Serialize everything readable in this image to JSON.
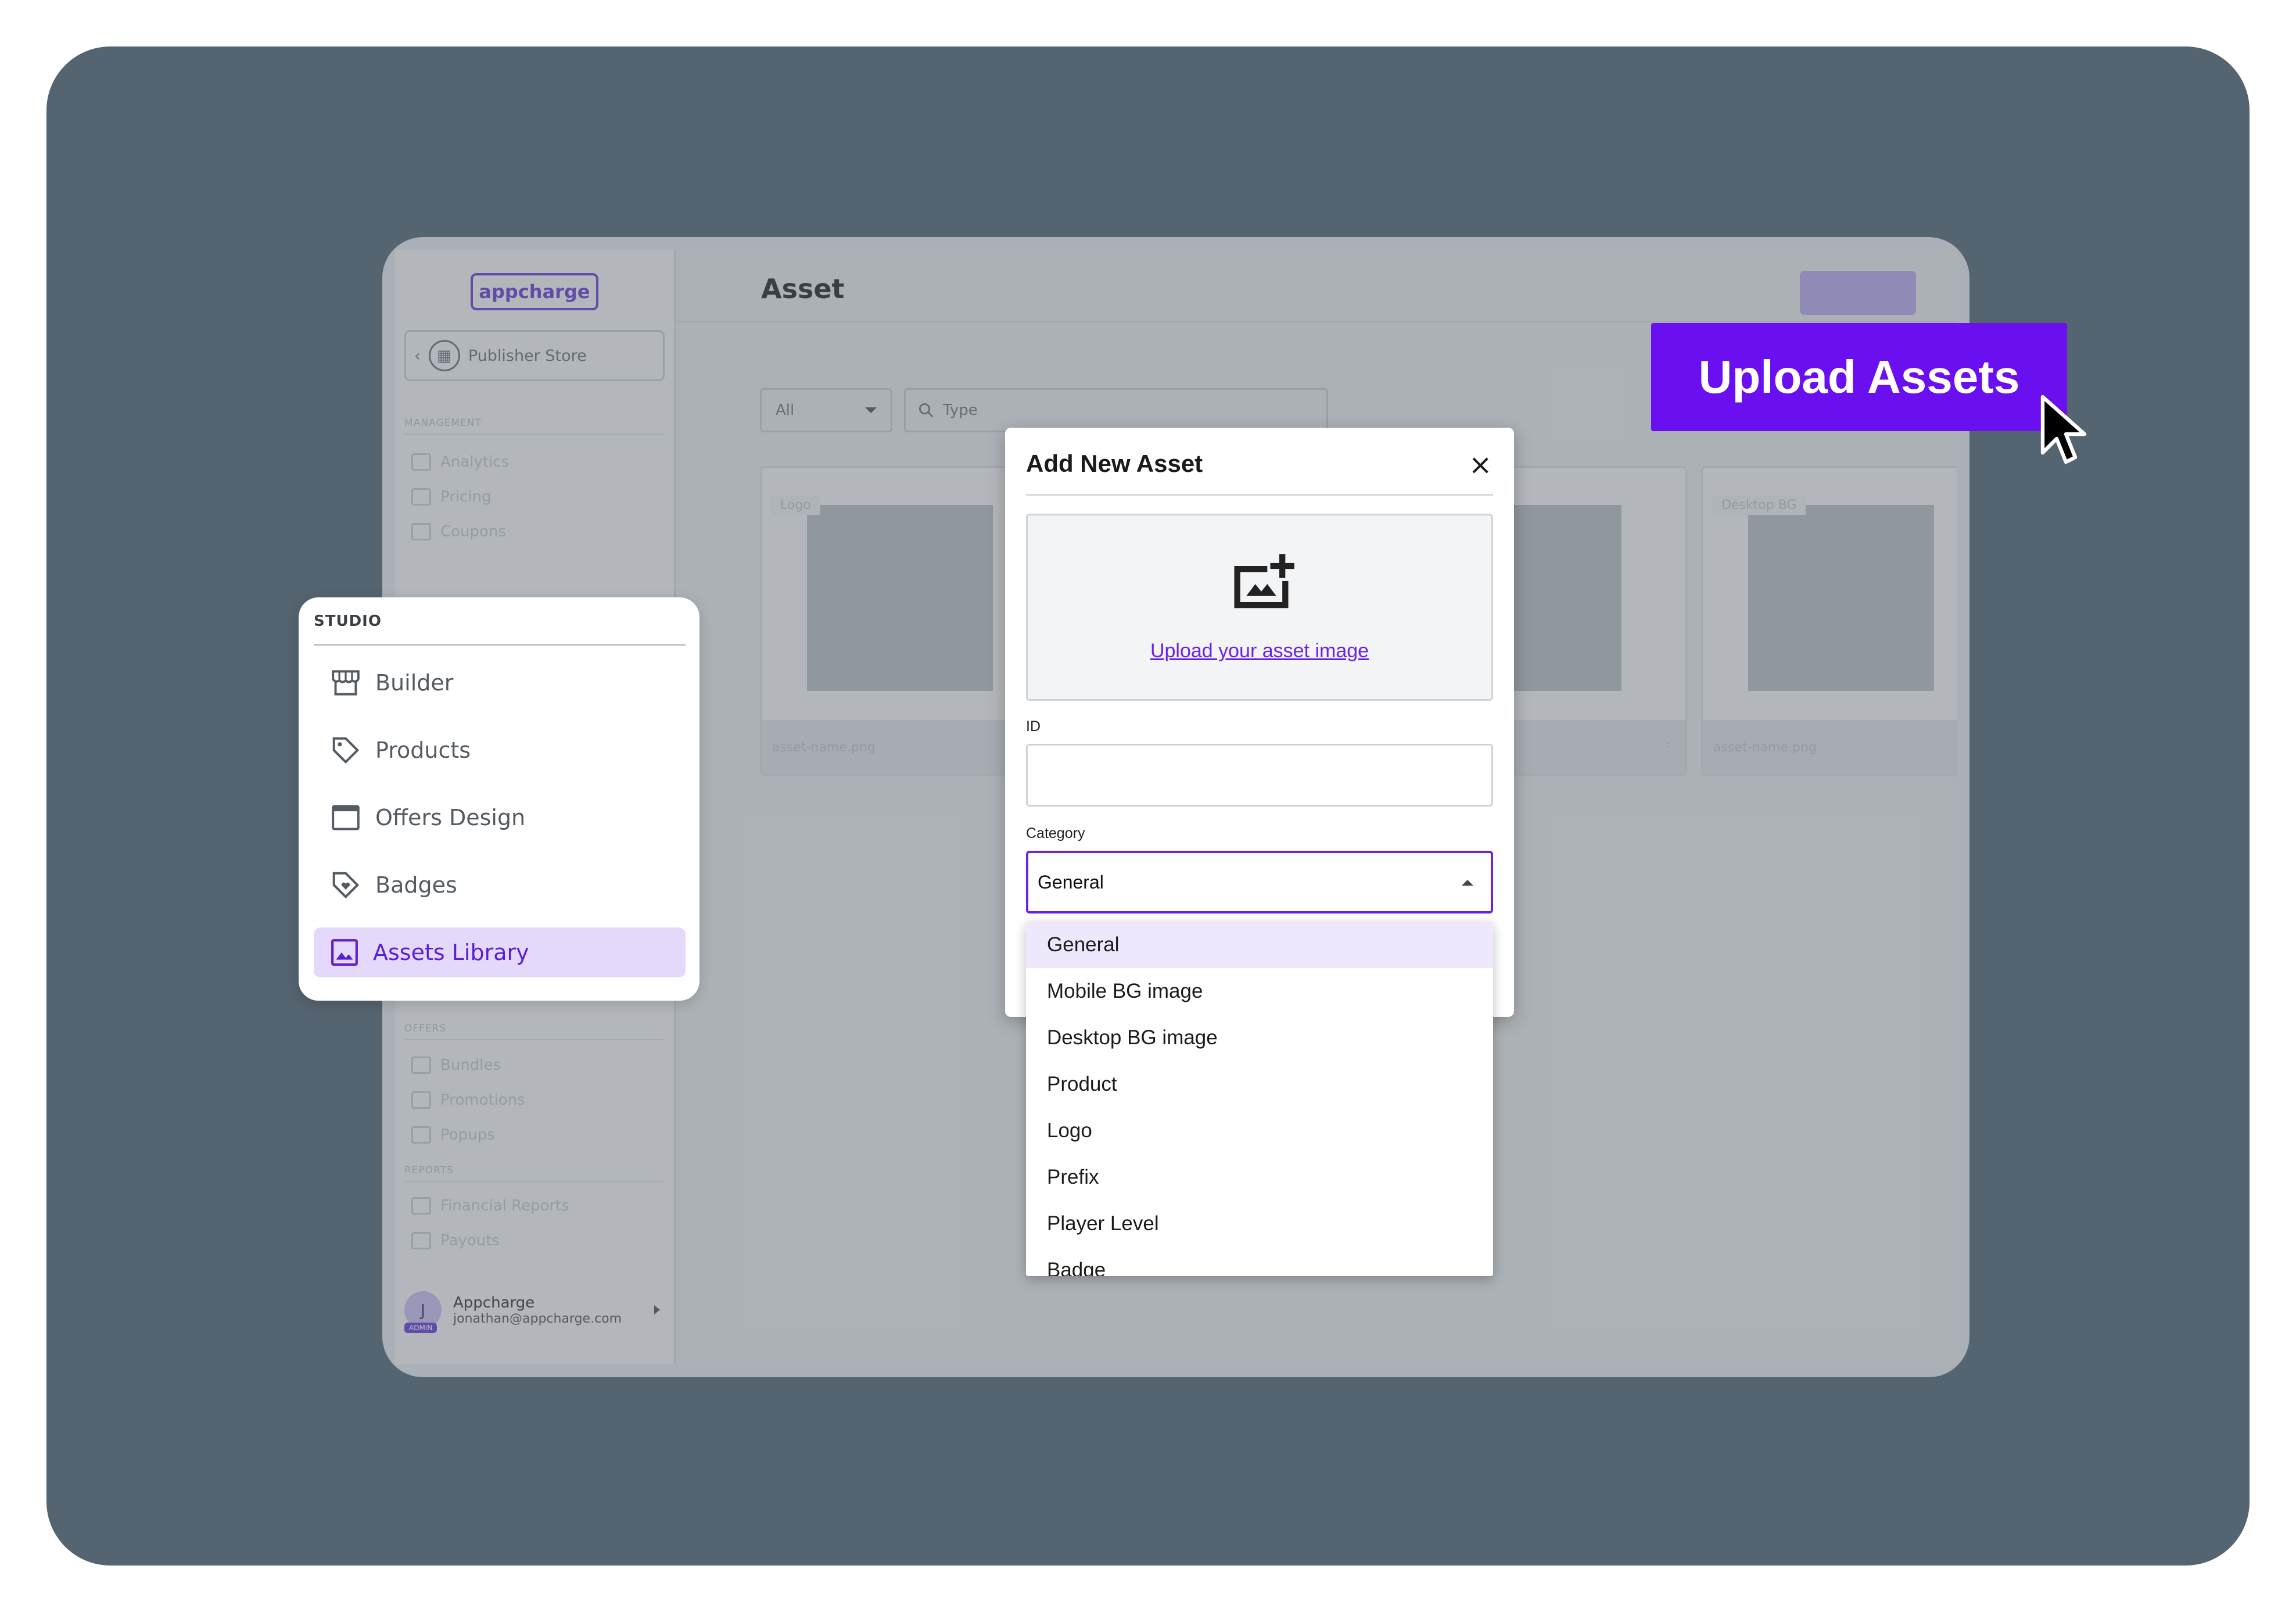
{
  "app": {
    "logo_text": "appcharge",
    "publisher_store": "Publisher Store",
    "page_title": "Asset"
  },
  "sidebar": {
    "sections": {
      "management": "MANAGEMENT",
      "offers": "OFFERS",
      "reports": "REPORTS"
    },
    "management_items": [
      "Analytics",
      "Pricing",
      "Coupons"
    ],
    "offers_items": [
      "Bundles",
      "Promotions",
      "Popups"
    ],
    "reports_items": [
      "Financial Reports",
      "Payouts"
    ],
    "user": {
      "initial": "J",
      "role": "ADMIN",
      "name": "Appcharge",
      "email": "jonathan@appcharge.com"
    }
  },
  "filters": {
    "category_value": "All",
    "search_placeholder": "Type"
  },
  "cards": [
    {
      "tag": "Logo",
      "filename": "asset-name.png"
    },
    {
      "tag": "",
      "filename": ""
    },
    {
      "tag": "Desktop BG",
      "filename": "asset-name.png"
    }
  ],
  "studio": {
    "heading": "STUDIO",
    "items": [
      "Builder",
      "Products",
      "Offers Design",
      "Badges",
      "Assets Library"
    ],
    "active": "Assets Library"
  },
  "modal": {
    "title": "Add New Asset",
    "upload_link": "Upload your asset image",
    "id_label": "ID",
    "id_value": "",
    "category_label": "Category",
    "category_value": "General",
    "options": [
      "General",
      "Mobile BG image",
      "Desktop BG image",
      "Product",
      "Logo",
      "Prefix",
      "Player Level",
      "Badge"
    ]
  },
  "callout": {
    "label": "Upload Assets"
  },
  "colors": {
    "stage_bg": "#546470",
    "accent": "#6a0ff0",
    "active_item_bg": "#e5d9fb"
  }
}
